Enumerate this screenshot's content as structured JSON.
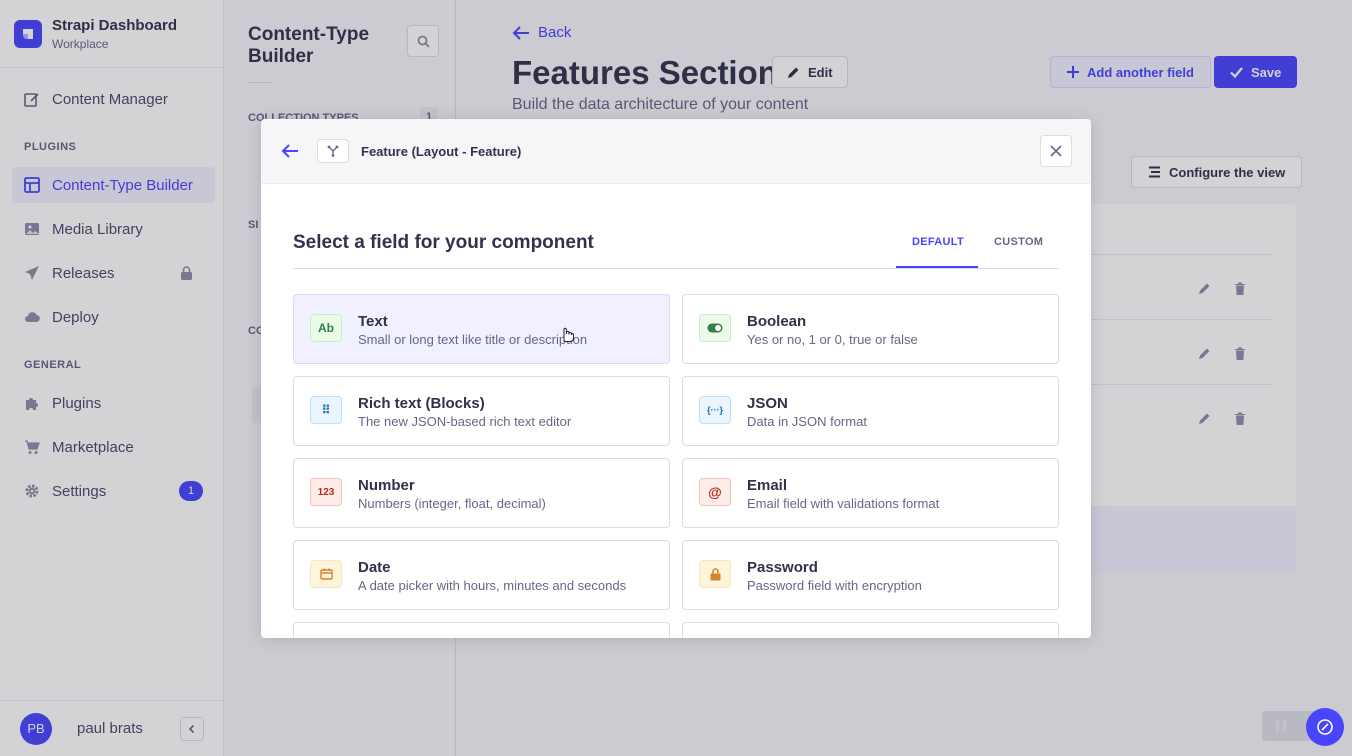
{
  "brand": {
    "title": "Strapi Dashboard",
    "subtitle": "Workplace"
  },
  "nav": {
    "content_manager": "Content Manager",
    "plugins_heading": "PLUGINS",
    "content_type_builder": "Content-Type Builder",
    "media_library": "Media Library",
    "releases": "Releases",
    "deploy": "Deploy",
    "general_heading": "GENERAL",
    "plugins": "Plugins",
    "marketplace": "Marketplace",
    "settings": "Settings",
    "settings_badge": "1"
  },
  "user": {
    "initials": "PB",
    "name": "paul brats"
  },
  "subnav": {
    "title": "Content-Type Builder",
    "collection_types": "COLLECTION TYPES",
    "collection_count": "1",
    "single_types_partial": "SI",
    "components_partial": "CO"
  },
  "header": {
    "back": "Back",
    "title": "Features Section",
    "edit": "Edit",
    "subtitle": "Build the data architecture of your content",
    "add_field": "Add another field",
    "save": "Save",
    "configure_view": "Configure the view"
  },
  "modal": {
    "breadcrumb": "Feature (Layout - Feature)",
    "title": "Select a field for your component",
    "tabs": {
      "default": "DEFAULT",
      "custom": "CUSTOM"
    },
    "fields": [
      {
        "icon": "Ab",
        "title": "Text",
        "desc": "Small or long text like title or description"
      },
      {
        "icon": "toggle",
        "title": "Boolean",
        "desc": "Yes or no, 1 or 0, true or false"
      },
      {
        "icon": "⠿",
        "title": "Rich text (Blocks)",
        "desc": "The new JSON-based rich text editor"
      },
      {
        "icon": "{···}",
        "title": "JSON",
        "desc": "Data in JSON format"
      },
      {
        "icon": "123",
        "title": "Number",
        "desc": "Numbers (integer, float, decimal)"
      },
      {
        "icon": "@",
        "title": "Email",
        "desc": "Email field with validations format"
      },
      {
        "icon": "calendar",
        "title": "Date",
        "desc": "A date picker with hours, minutes and seconds"
      },
      {
        "icon": "lock",
        "title": "Password",
        "desc": "Password field with encryption"
      }
    ]
  },
  "colors": {
    "primary": "#4945ff",
    "text": "#32324d",
    "muted": "#666687"
  }
}
